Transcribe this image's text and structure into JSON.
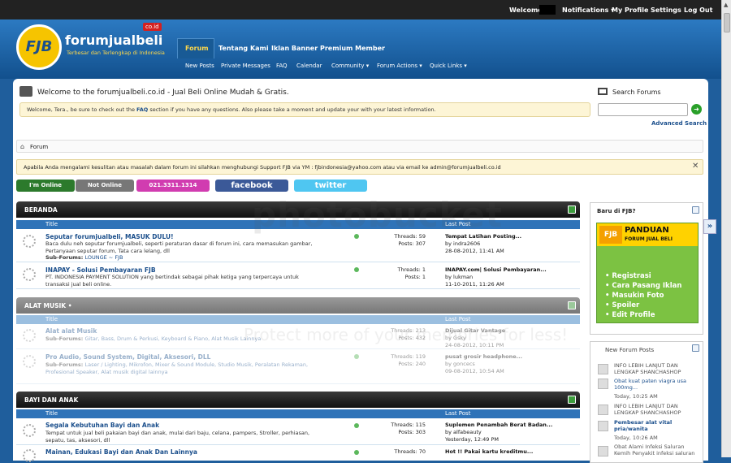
{
  "topbar": {
    "welcome": "Welcome,",
    "notifications": "Notifications ▾",
    "my_profile": "My Profile",
    "settings": "Settings",
    "logout": "Log Out"
  },
  "brand": {
    "logo": "FJB",
    "name": "forumjualbeli",
    "tld": "co.id",
    "slogan": "Terbesar dan Terlengkap di Indonesia"
  },
  "mainnav": [
    "Forum",
    "Tentang Kami",
    "Iklan Banner",
    "Premium Member"
  ],
  "subnav": [
    "New Posts",
    "Private Messages",
    "FAQ",
    "Calendar",
    "Community ▾",
    "Forum Actions ▾",
    "Quick Links ▾"
  ],
  "welcome_title": "Welcome to the forumjualbeli.co.id - Jual Beli Online Mudah & Gratis.",
  "notice": {
    "pre": "Welcome, Tera., be sure to check out the ",
    "faq": "FAQ",
    "post": " section if you have any questions. Also please take a moment and update your with your latest information."
  },
  "search": {
    "label": "Search Forums",
    "advanced": "Advanced Search",
    "go": "➜"
  },
  "breadcrumb": "Forum",
  "alert": "Apabila Anda mengalami kesulitan atau masalah dalam forum ini silahkan menghubungi Support FJB via YM : fjbindonesia@yahoo.com atau via email ke admin@forumjualbeli.co.id",
  "promos": [
    "I'm Online",
    "Not Online",
    "021.3311.1314",
    "facebook",
    "twitter"
  ],
  "col": {
    "title": "Title",
    "lastpost": "Last Post"
  },
  "sections": [
    {
      "name": "BERANDA",
      "rows": [
        {
          "title": "Seputar forumjualbeli, MASUK DULU!",
          "desc": "Baca dulu neh seputar forumjualbeli, seperti peraturan dasar di forum ini, cara memasukan gambar, Pertanyaan seputar forum, Tata cara lelang, dll",
          "sub_label": "Sub-Forums:",
          "sub": "LOUNGE ~ FJB",
          "threads": "Threads: 59",
          "posts": "Posts: 307",
          "lp_title": "Tempat Latihan Posting...",
          "lp_by": "by indra2606",
          "lp_date": "28-08-2012, 11:41 AM"
        },
        {
          "title": "INAPAY - Solusi Pembayaran FJB",
          "desc": "PT. INDONESIA PAYMENT SOLUTION yang bertindak sebagai pihak ketiga yang terpercaya untuk transaksi jual beli online.",
          "threads": "Threads: 1",
          "posts": "Posts: 1",
          "lp_title": "INAPAY.com| Solusi Pembayaran...",
          "lp_by": "by lukman",
          "lp_date": "11-10-2011, 11:26 AM"
        }
      ]
    },
    {
      "name": "ALAT MUSIK •",
      "rows": [
        {
          "title": "Alat alat Musik",
          "sub_label": "Sub-Forums:",
          "sub": "Gitar,   Bass,   Drum & Perkusi,   Keyboard & Piano,   Alat Musik Lainnya",
          "threads": "Threads: 213",
          "posts": "Posts: 432",
          "lp_title": "Dijual Gitar Vantage",
          "lp_by": "by Gsky",
          "lp_date": "24-08-2012, 10:11 PM"
        },
        {
          "title": "Pro Audio, Sound System, Digital, Aksesori, DLL",
          "sub_label": "Sub-Forums:",
          "sub": "Laser / Lighting,   Mikrofon,   Mixer & Sound Module,   Studio Musik,   Peralatan Rekaman,   Profesional Speaker,   Alat musik digital lainnya",
          "threads": "Threads: 119",
          "posts": "Posts: 240",
          "lp_title": "pusat grosir headphone...",
          "lp_by": "by goncecs",
          "lp_date": "09-08-2012, 10:54 AM"
        }
      ]
    },
    {
      "name": "BAYI DAN ANAK",
      "rows": [
        {
          "title": "Segala Kebutuhan Bayi dan Anak",
          "desc": "Tempat untuk jual beli pakaian bayi dan anak, mulai dari baju, celana, pampers, Stroller, perhiasan, sepatu, tas, aksesori, dll",
          "threads": "Threads: 115",
          "posts": "Posts: 303",
          "lp_title": "Suplemen Penambah Berat Badan...",
          "lp_by": "by alfabeauty",
          "lp_date": "Yesterday, 12:49 PM"
        },
        {
          "title": "Mainan, Edukasi Bayi dan Anak Dan Lainnya",
          "threads": "Threads: 70",
          "lp_title": "Hot !! Pakai kartu kreditmu..."
        }
      ]
    }
  ],
  "sidebar": {
    "baru_title": "Baru di FJB?",
    "banner": {
      "logo": "FJB",
      "l1": "PANDUAN",
      "l2": "FORUM JUAL BELI",
      "items": [
        "• Registrasi",
        "• Cara Pasang Iklan",
        "• Masukin Foto",
        "• Spoiler",
        "• Edit Profile"
      ]
    },
    "new_posts_title": "New Forum Posts",
    "posts": [
      {
        "text": "INFO LEBIH LANJUT DAN LENGKAP SHANCHASHOP",
        "date": ""
      },
      {
        "text": "Obat kuat paten viagra usa 100mg...",
        "date": "Today, 10:25 AM",
        "bold": true
      },
      {
        "text": "INFO LEBIH LANJUT DAN LENGKAP SHANCHASHOP",
        "date": ""
      },
      {
        "text": "Pembesar alat vital pria/wanita",
        "date": "Today, 10:26 AM",
        "bold": true
      },
      {
        "text": "Obat Alami Infeksi Saluran Kemih Penyakit infeksi saluran",
        "date": ""
      }
    ]
  },
  "watermark": "photobucket",
  "watermark2": "Protect more of your memories for less!"
}
